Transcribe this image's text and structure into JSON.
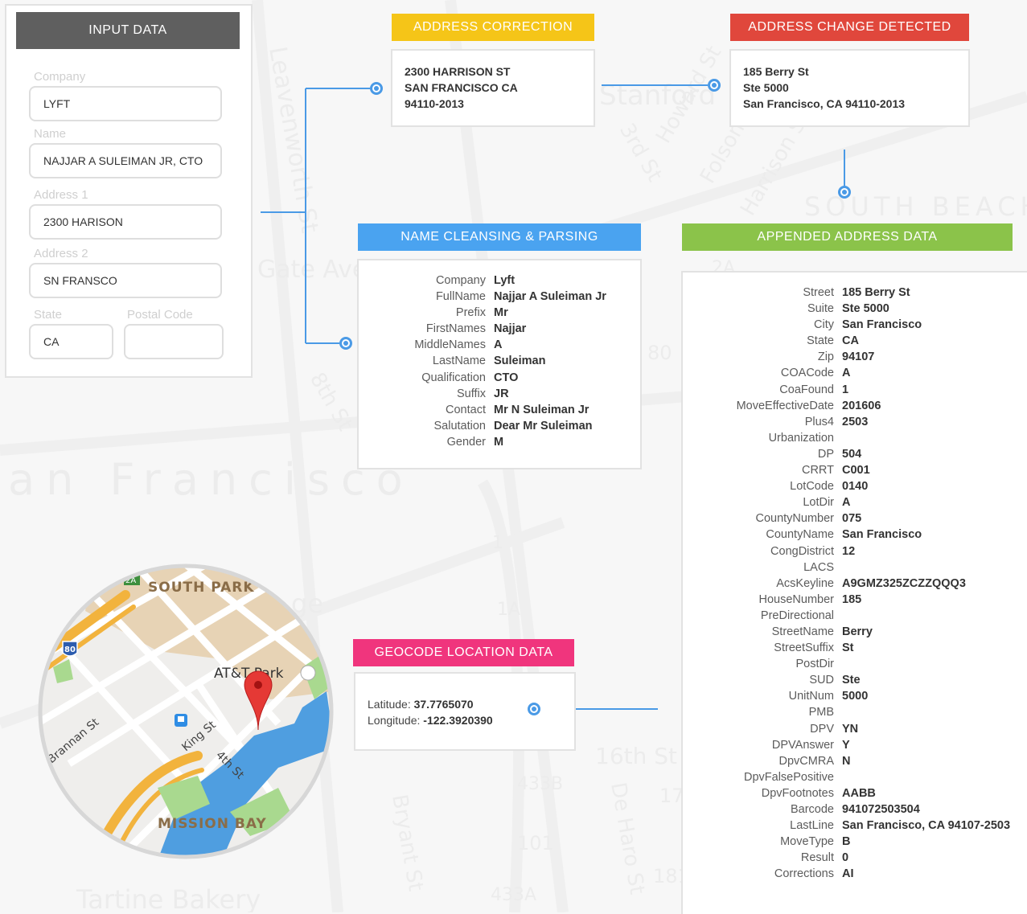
{
  "background_map": {
    "labels": [
      "Leavenworth St",
      "Gate Ave",
      "Stanford",
      "Howard St",
      "Folsom St",
      "Harrison St",
      "SOUTH BEACH",
      "3rd St",
      "8th St",
      "an Francisco",
      "16th St",
      "De Haro St",
      "Bryant St",
      "Tartine Bakery",
      "80",
      "1",
      "1A",
      "433B",
      "101",
      "433A",
      "17",
      "181",
      "2A",
      "ge"
    ]
  },
  "input_panel": {
    "title": "INPUT DATA",
    "company_label": "Company",
    "company_value": "LYFT",
    "name_label": "Name",
    "name_value": "NAJJAR A SULEIMAN JR, CTO",
    "address1_label": "Address 1",
    "address1_value": "2300 HARISON",
    "address2_label": "Address 2",
    "address2_value": "SN FRANSCO",
    "state_label": "State",
    "state_value": "CA",
    "postal_label": "Postal Code",
    "postal_value": ""
  },
  "address_correction": {
    "title": "ADDRESS CORRECTION",
    "color": "#f5c518",
    "lines": [
      "2300 HARRISON ST",
      "SAN FRANCISCO CA",
      "94110-2013"
    ]
  },
  "address_change": {
    "title": "ADDRESS CHANGE DETECTED",
    "color": "#e0473c",
    "lines": [
      "185 Berry St",
      "Ste 5000",
      "San Francisco, CA 94110-2013"
    ]
  },
  "name_cleansing": {
    "title": "NAME CLEANSING & PARSING",
    "color": "#4aa3f0",
    "rows": [
      {
        "k": "Company",
        "v": "Lyft"
      },
      {
        "k": "FullName",
        "v": "Najjar A Suleiman Jr"
      },
      {
        "k": "Prefix",
        "v": "Mr"
      },
      {
        "k": "FirstNames",
        "v": "Najjar"
      },
      {
        "k": "MiddleNames",
        "v": "A"
      },
      {
        "k": "LastName",
        "v": "Suleiman"
      },
      {
        "k": "Qualification",
        "v": "CTO"
      },
      {
        "k": "Suffix",
        "v": "JR"
      },
      {
        "k": "Contact",
        "v": "Mr N Suleiman Jr"
      },
      {
        "k": "Salutation",
        "v": "Dear Mr Suleiman"
      },
      {
        "k": "Gender",
        "v": "M"
      }
    ]
  },
  "appended_address": {
    "title": "APPENDED ADDRESS DATA",
    "color": "#8bc34a",
    "rows": [
      {
        "k": "Street",
        "v": "185 Berry St"
      },
      {
        "k": "Suite",
        "v": "Ste 5000"
      },
      {
        "k": "City",
        "v": "San Francisco"
      },
      {
        "k": "State",
        "v": "CA"
      },
      {
        "k": "Zip",
        "v": "94107"
      },
      {
        "k": "COACode",
        "v": "A"
      },
      {
        "k": "CoaFound",
        "v": "1"
      },
      {
        "k": "MoveEffectiveDate",
        "v": "201606"
      },
      {
        "k": "Plus4",
        "v": "2503"
      },
      {
        "k": "Urbanization",
        "v": ""
      },
      {
        "k": "DP",
        "v": "504"
      },
      {
        "k": "CRRT",
        "v": "C001"
      },
      {
        "k": "LotCode",
        "v": "0140"
      },
      {
        "k": "LotDir",
        "v": "A"
      },
      {
        "k": "CountyNumber",
        "v": "075"
      },
      {
        "k": "CountyName",
        "v": "San Francisco"
      },
      {
        "k": "CongDistrict",
        "v": "12"
      },
      {
        "k": "LACS",
        "v": ""
      },
      {
        "k": "AcsKeyline",
        "v": "A9GMZ325ZCZZQQQ3"
      },
      {
        "k": "HouseNumber",
        "v": "185"
      },
      {
        "k": "PreDirectional",
        "v": ""
      },
      {
        "k": "StreetName",
        "v": "Berry"
      },
      {
        "k": "StreetSuffix",
        "v": "St"
      },
      {
        "k": "PostDir",
        "v": ""
      },
      {
        "k": "SUD",
        "v": "Ste"
      },
      {
        "k": "UnitNum",
        "v": "5000"
      },
      {
        "k": "PMB",
        "v": ""
      },
      {
        "k": "DPV",
        "v": "YN"
      },
      {
        "k": "DPVAnswer",
        "v": "Y"
      },
      {
        "k": "DpvCMRA",
        "v": "N"
      },
      {
        "k": "DpvFalsePositive",
        "v": ""
      },
      {
        "k": "DpvFootnotes",
        "v": "AABB"
      },
      {
        "k": "Barcode",
        "v": "941072503504"
      },
      {
        "k": "LastLine",
        "v": "San Francisco, CA 94107-2503"
      },
      {
        "k": "MoveType",
        "v": "B"
      },
      {
        "k": "Result",
        "v": "0"
      },
      {
        "k": "Corrections",
        "v": "AI"
      }
    ]
  },
  "geocode": {
    "title": "GEOCODE LOCATION DATA",
    "color": "#f0357d",
    "lat_label": "Latitude:",
    "lat_value": "37.7765070",
    "lon_label": "Longitude:",
    "lon_value": "-122.3920390"
  },
  "location_map": {
    "labels": {
      "south_park": "SOUTH PARK",
      "att_park": "AT&T Park",
      "brannan": "Brannan St",
      "king": "King St",
      "fourth": "4th St",
      "mission_bay": "MISSION BAY",
      "hwy80": "80",
      "hwy2a": "2A"
    }
  }
}
